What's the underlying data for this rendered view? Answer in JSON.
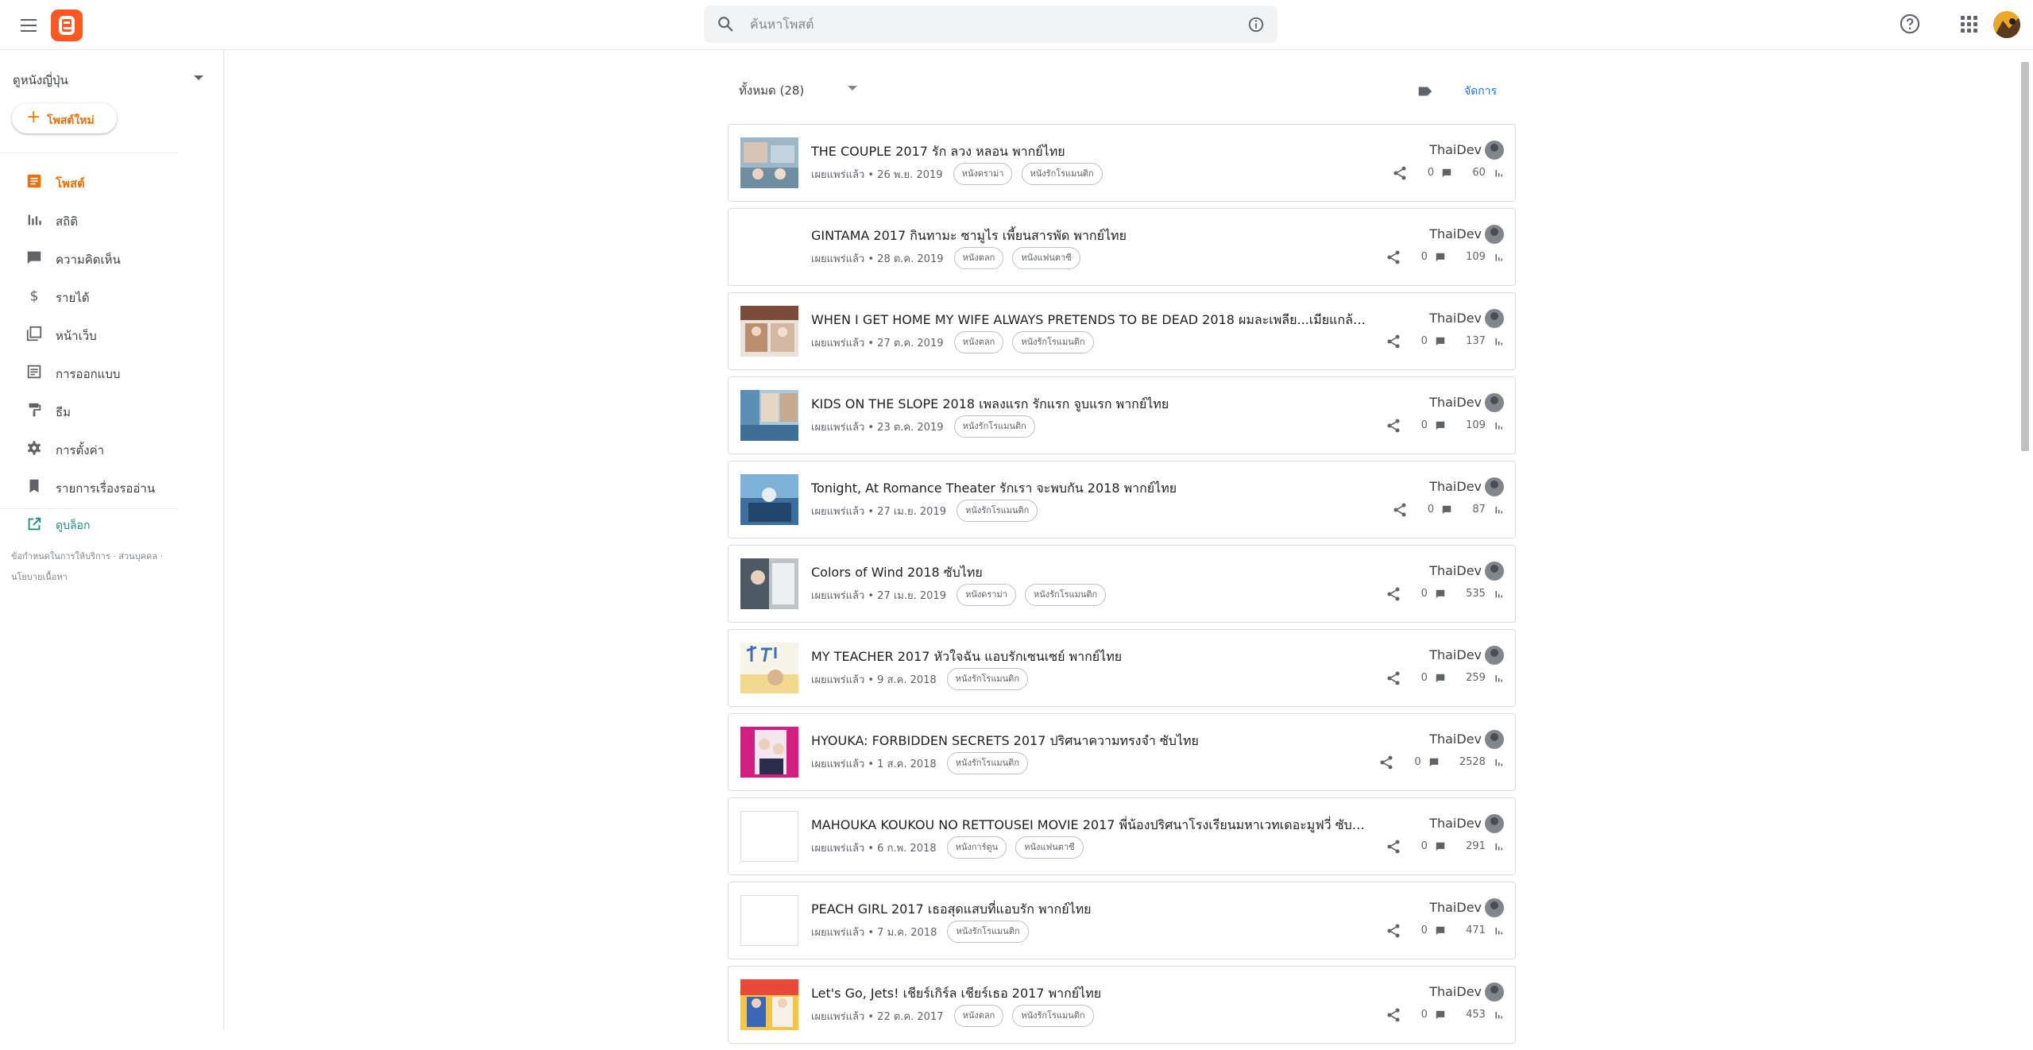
{
  "search": {
    "placeholder": "ค้นหาโพสต์"
  },
  "sidebar": {
    "blog_name": "ดูหนังญี่ปุ่น",
    "new_post": "โพสต์ใหม่",
    "items": [
      {
        "label": "โพสต์",
        "icon": "posts-icon"
      },
      {
        "label": "สถิติ",
        "icon": "stats-icon"
      },
      {
        "label": "ความคิดเห็น",
        "icon": "comment-icon"
      },
      {
        "label": "รายได้",
        "icon": "dollar-icon"
      },
      {
        "label": "หน้าเว็บ",
        "icon": "pages-icon"
      },
      {
        "label": "การออกแบบ",
        "icon": "layout-icon"
      },
      {
        "label": "ธีม",
        "icon": "theme-icon"
      },
      {
        "label": "การตั้งค่า",
        "icon": "gear-icon"
      },
      {
        "label": "รายการเรื่องรออ่าน",
        "icon": "bookmark-icon"
      }
    ],
    "view_blog": "ดูบล็อก",
    "footer": {
      "terms": "ข้อกำหนดในการให้บริการ",
      "privacy": "ส่วนบุคคล",
      "content_policy": "นโยบายเนื้อหา"
    }
  },
  "main": {
    "filter_label": "ทั้งหมด (28)",
    "manage_label": "จัดการ",
    "posts": [
      {
        "title": "THE COUPLE 2017 รัก ลวง หลอน พากย์ไทย",
        "status": "เผยแพร่แล้ว • 26 พ.ย. 2019",
        "labels": [
          "หนังดราม่า",
          "หนังรักโรแมนติก"
        ],
        "author": "ThaiDev",
        "comments": "0",
        "views": "60"
      },
      {
        "title": "GINTAMA 2017 กินทามะ ซามูไร เพี้ยนสารพัด พากย์ไทย",
        "status": "เผยแพร่แล้ว • 28 ต.ค. 2019",
        "labels": [
          "หนังตลก",
          "หนังแฟนตาซี"
        ],
        "author": "ThaiDev",
        "comments": "0",
        "views": "109"
      },
      {
        "title": "WHEN I GET HOME MY WIFE ALWAYS PRETENDS TO BE DEAD 2018 ผมละเพลีย...เมียแกล้งตาย...",
        "status": "เผยแพร่แล้ว • 27 ต.ค. 2019",
        "labels": [
          "หนังตลก",
          "หนังรักโรแมนติก"
        ],
        "author": "ThaiDev",
        "comments": "0",
        "views": "137"
      },
      {
        "title": "KIDS ON THE SLOPE 2018 เพลงแรก รักแรก จูบแรก พากย์ไทย",
        "status": "เผยแพร่แล้ว • 23 ต.ค. 2019",
        "labels": [
          "หนังรักโรแมนติก"
        ],
        "author": "ThaiDev",
        "comments": "0",
        "views": "109"
      },
      {
        "title": "Tonight, At Romance Theater รักเรา จะพบกัน 2018 พากย์ไทย",
        "status": "เผยแพร่แล้ว • 27 เม.ย. 2019",
        "labels": [
          "หนังรักโรแมนติก"
        ],
        "author": "ThaiDev",
        "comments": "0",
        "views": "87"
      },
      {
        "title": "Colors of Wind 2018 ซับไทย",
        "status": "เผยแพร่แล้ว • 27 เม.ย. 2019",
        "labels": [
          "หนังดราม่า",
          "หนังรักโรแมนติก"
        ],
        "author": "ThaiDev",
        "comments": "0",
        "views": "535"
      },
      {
        "title": "MY TEACHER 2017 หัวใจฉัน แอบรักเซนเซย์ พากย์ไทย",
        "status": "เผยแพร่แล้ว • 9 ส.ค. 2018",
        "labels": [
          "หนังรักโรแมนติก"
        ],
        "author": "ThaiDev",
        "comments": "0",
        "views": "259"
      },
      {
        "title": "HYOUKA: FORBIDDEN SECRETS 2017 ปริศนาความทรงจำ ซับไทย",
        "status": "เผยแพร่แล้ว • 1 ส.ค. 2018",
        "labels": [
          "หนังรักโรแมนติก"
        ],
        "author": "ThaiDev",
        "comments": "0",
        "views": "2528"
      },
      {
        "title": "MAHOUKA KOUKOU NO RETTOUSEI MOVIE 2017 พี่น้องปริศนาโรงเรียนมหาเวทเดอะมูฟวี่ ซับไทย",
        "status": "เผยแพร่แล้ว • 6 ก.พ. 2018",
        "labels": [
          "หนังการ์ตูน",
          "หนังแฟนตาซี"
        ],
        "author": "ThaiDev",
        "comments": "0",
        "views": "291"
      },
      {
        "title": "PEACH GIRL 2017 เธอสุดแสบที่แอบรัก พากย์ไทย",
        "status": "เผยแพร่แล้ว • 7 ม.ค. 2018",
        "labels": [
          "หนังรักโรแมนติก"
        ],
        "author": "ThaiDev",
        "comments": "0",
        "views": "471"
      },
      {
        "title": "Let's Go, Jets! เชียร์เกิร์ล เชียร์เธอ 2017 พากย์ไทย",
        "status": "เผยแพร่แล้ว • 22 ต.ค. 2017",
        "labels": [
          "หนังตลก",
          "หนังรักโรแมนติก"
        ],
        "author": "ThaiDev",
        "comments": "0",
        "views": "453"
      }
    ]
  },
  "colors": {
    "accent": "#e8710a",
    "link": "#1a73e8",
    "blogger_brand": "#ff5722",
    "view_blog": "#1e8e7e"
  }
}
